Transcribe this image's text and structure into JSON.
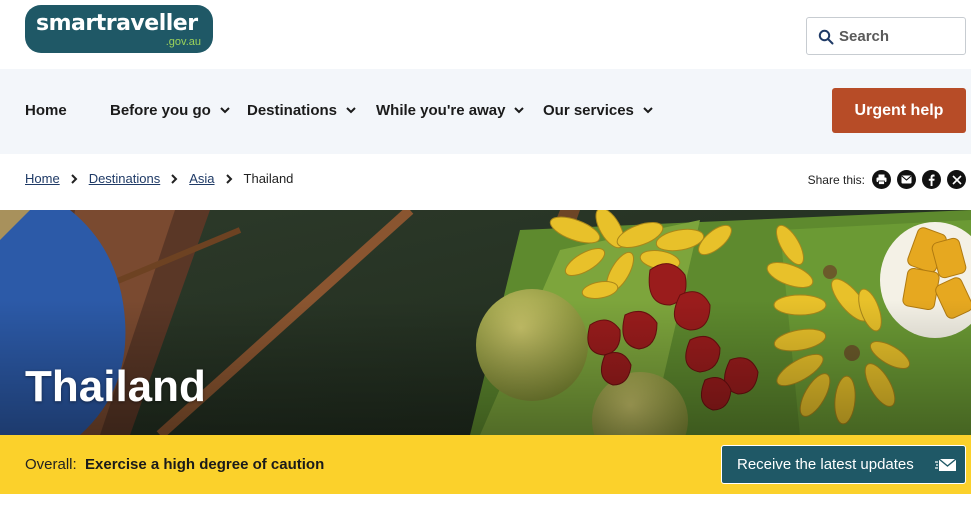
{
  "logo": {
    "word": "smartraveller",
    "domain": ".gov.au"
  },
  "search": {
    "placeholder": "Search"
  },
  "nav": {
    "items": [
      {
        "label": "Home",
        "dropdown": false
      },
      {
        "label": "Before you go",
        "dropdown": true
      },
      {
        "label": "Destinations",
        "dropdown": true
      },
      {
        "label": "While you're away",
        "dropdown": true
      },
      {
        "label": "Our services",
        "dropdown": true
      }
    ],
    "urgent_label": "Urgent help"
  },
  "breadcrumb": {
    "links": [
      "Home",
      "Destinations",
      "Asia"
    ],
    "current": "Thailand"
  },
  "share": {
    "label": "Share this:",
    "icons": [
      "print-icon",
      "email-icon",
      "facebook-icon",
      "x-icon"
    ]
  },
  "hero": {
    "title": "Thailand"
  },
  "alert": {
    "label": "Overall:",
    "level": "Exercise a high degree of caution",
    "updates_label": "Receive the latest updates"
  },
  "colors": {
    "brand_teal": "#1f5866",
    "urgent": "#b74c27",
    "alert_yellow": "#fbd12b",
    "nav_bg": "#f3f6fa"
  }
}
